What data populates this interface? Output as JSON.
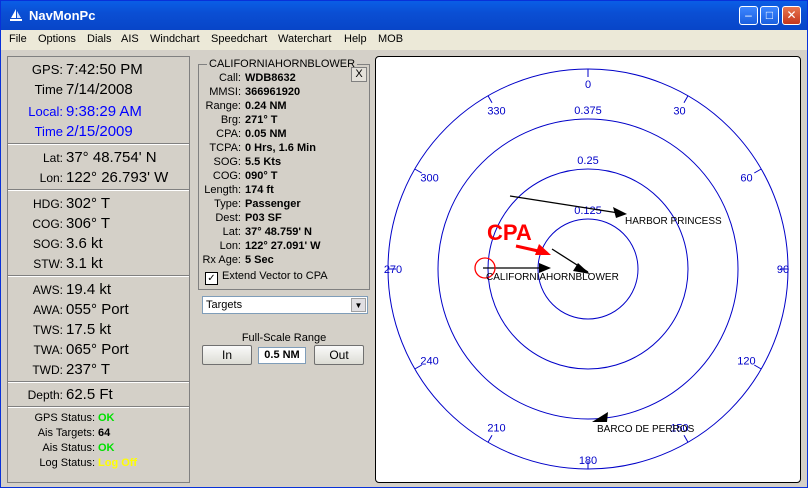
{
  "window": {
    "title": "NavMonPc"
  },
  "menu": [
    "File",
    "Options",
    "Dials",
    "AIS",
    "Windchart",
    "Speedchart",
    "Waterchart",
    "Help",
    "MOB"
  ],
  "time": {
    "gps_label": "GPS:",
    "gps_time": "7:42:50 PM",
    "gps_date_label": "Time",
    "gps_date": "7/14/2008",
    "local_label": "Local:",
    "local_time": "9:38:29 AM",
    "local_date_label": "Time",
    "local_date": "2/15/2009"
  },
  "position": {
    "lat_label": "Lat:",
    "lat": "37° 48.754' N",
    "lon_label": "Lon:",
    "lon": "122° 26.793' W"
  },
  "nav": [
    {
      "label": "HDG:",
      "value": "302° T"
    },
    {
      "label": "COG:",
      "value": "306° T"
    },
    {
      "label": "SOG:",
      "value": "3.6 kt"
    },
    {
      "label": "STW:",
      "value": "3.1 kt"
    }
  ],
  "wind": [
    {
      "label": "AWS:",
      "value": "19.4 kt"
    },
    {
      "label": "AWA:",
      "value": "055° Port"
    },
    {
      "label": "TWS:",
      "value": "17.5 kt"
    },
    {
      "label": "TWA:",
      "value": "065° Port"
    },
    {
      "label": "TWD:",
      "value": "237° T"
    }
  ],
  "depth": {
    "label": "Depth:",
    "value": "62.5 Ft"
  },
  "status": [
    {
      "label": "GPS Status:",
      "value": "OK",
      "color": "#00e000"
    },
    {
      "label": "Ais Targets:",
      "value": "64",
      "color": "#000000"
    },
    {
      "label": "Ais Status:",
      "value": "OK",
      "color": "#00e000"
    },
    {
      "label": "Log Status:",
      "value": "Log Off",
      "color": "#ffff00"
    }
  ],
  "target": {
    "name": "CALIFORNIAHORNBLOWER",
    "close_label": "X",
    "fields": [
      {
        "label": "Call:",
        "value": "WDB8632"
      },
      {
        "label": "MMSI:",
        "value": "366961920"
      },
      {
        "label": "Range:",
        "value": "0.24 NM"
      },
      {
        "label": "Brg:",
        "value": "271° T"
      },
      {
        "label": "CPA:",
        "value": "0.05 NM"
      },
      {
        "label": "TCPA:",
        "value": "0 Hrs, 1.6 Min"
      },
      {
        "label": "SOG:",
        "value": "5.5 Kts"
      },
      {
        "label": "COG:",
        "value": "090° T"
      },
      {
        "label": "Length:",
        "value": "174 ft"
      },
      {
        "label": "Type:",
        "value": "Passenger"
      },
      {
        "label": "Dest:",
        "value": "P03 SF"
      },
      {
        "label": "Lat:",
        "value": "37° 48.759' N"
      },
      {
        "label": "Lon:",
        "value": "122° 27.091' W"
      },
      {
        "label": "Rx Age:",
        "value": "5 Sec"
      }
    ],
    "extend_vector_label": "Extend Vector to CPA",
    "extend_vector_checked": "✓"
  },
  "dropdown": {
    "selected": "Targets"
  },
  "range": {
    "label": "Full-Scale Range",
    "in_label": "In",
    "value": "0.5 NM",
    "out_label": "Out"
  },
  "radar": {
    "ring_labels": [
      "0.125",
      "0.25",
      "0.375"
    ],
    "bearing_labels": [
      "0",
      "30",
      "60",
      "90",
      "120",
      "150",
      "180",
      "210",
      "240",
      "270",
      "300",
      "330"
    ],
    "cpa_label": "CPA",
    "targets": [
      "HARBOR PRINCESS",
      "CALIFORNIAHORNBLOWER",
      "BARCO DE PERROS"
    ],
    "ring_color": "#0000c8",
    "cpa_color": "#ff0000"
  }
}
